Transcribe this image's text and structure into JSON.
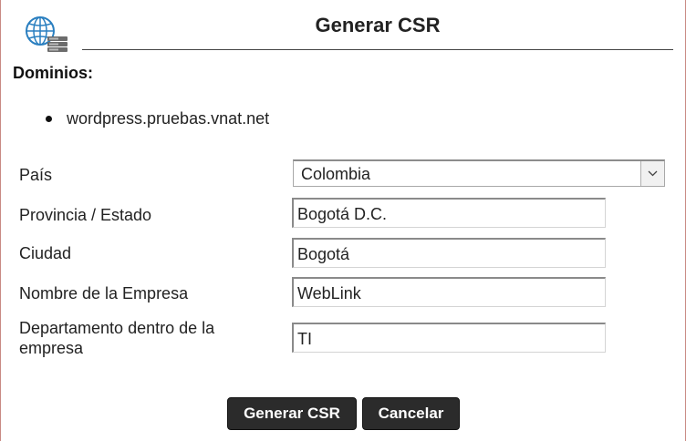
{
  "dialog": {
    "title": "Generar CSR",
    "logo_icon": "globe-server-icon"
  },
  "domains": {
    "label": "Dominios:",
    "items": [
      "wordpress.pruebas.vnat.net"
    ]
  },
  "form": {
    "country": {
      "label": "País",
      "value": "Colombia"
    },
    "state": {
      "label": "Provincia / Estado",
      "value": "Bogotá D.C."
    },
    "city": {
      "label": "Ciudad",
      "value": "Bogotá"
    },
    "company": {
      "label": "Nombre de la Empresa",
      "value": "WebLink"
    },
    "department": {
      "label_line1": "Departamento dentro de la",
      "label_line2": "empresa",
      "value": "TI"
    }
  },
  "buttons": {
    "submit": "Generar CSR",
    "cancel": "Cancelar"
  },
  "colors": {
    "button_bg": "#2b2b2b",
    "logo_blue": "#2a7fc0",
    "frame_border": "#c98a84"
  }
}
